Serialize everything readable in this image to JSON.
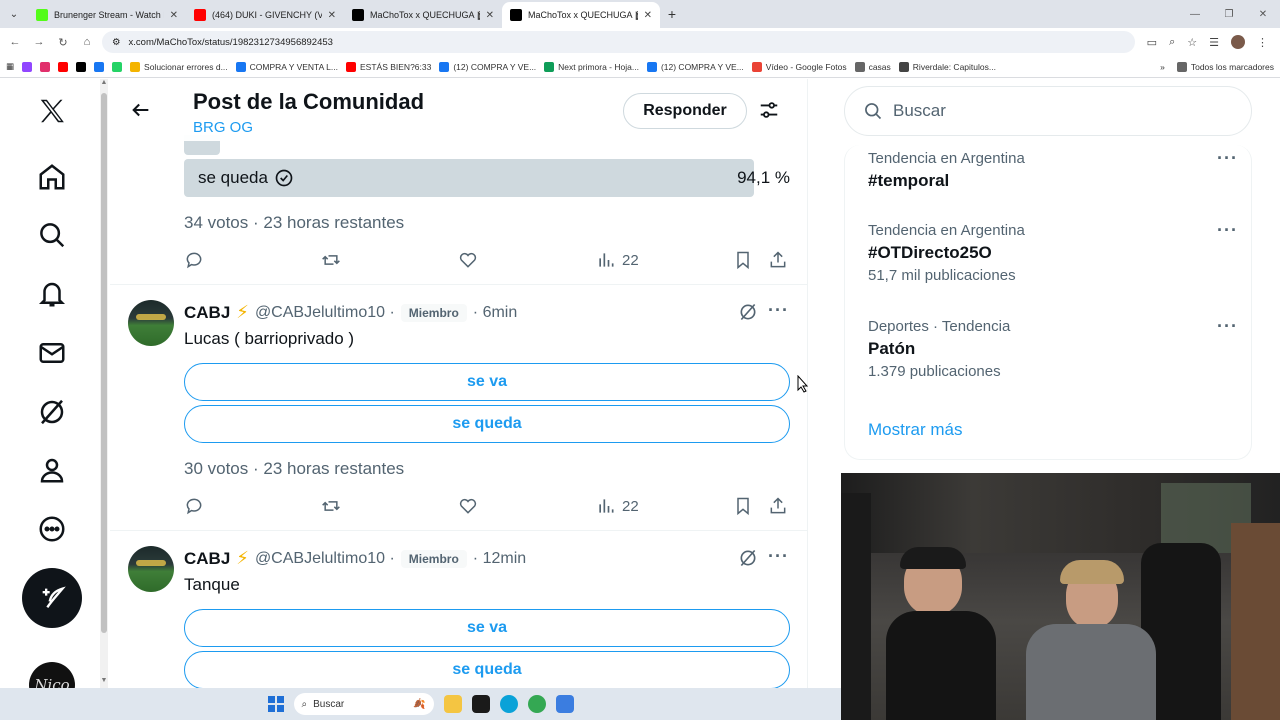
{
  "browser": {
    "tabs": [
      {
        "title": "Brunenger Stream - Watch Live",
        "favicon_color": "#53fc18"
      },
      {
        "title": "(464) DUKI - GIVENCHY (Vi",
        "favicon_color": "#ff0000"
      },
      {
        "title": "MaChoTox x QUECHUGA 🎬 e",
        "favicon_color": "#000000"
      },
      {
        "title": "MaChoTox x QUECHUGA 🎬 e",
        "favicon_color": "#000000"
      }
    ],
    "url": "x.com/MaChoTox/status/1982312734956892453",
    "bookmarks": [
      {
        "label": "Solucionar errores d...",
        "color": "#f4b400"
      },
      {
        "label": "COMPRA Y VENTA L...",
        "color": "#1877f2"
      },
      {
        "label": "ESTÁS BIEN?6:33",
        "color": "#ff0000"
      },
      {
        "label": "(12) COMPRA Y VE...",
        "color": "#1877f2"
      },
      {
        "label": "Next primora - Hoja...",
        "color": "#0f9d58"
      },
      {
        "label": "(12) COMPRA Y VE...",
        "color": "#1877f2"
      },
      {
        "label": "Vídeo - Google Fotos",
        "color": "#ea4335"
      },
      {
        "label": "casas",
        "color": "#666666"
      },
      {
        "label": "Riverdale: Capitulos...",
        "color": "#444444"
      }
    ],
    "all_bookmarks": "Todos los marcadores"
  },
  "header": {
    "title": "Post de la Comunidad",
    "subtitle": "BRG OG",
    "reply_label": "Responder"
  },
  "top_poll": {
    "option_label": "se queda",
    "percent": "94,1 %",
    "percent_value": 94.1,
    "meta": "34 votos · 23 horas restantes",
    "views": "22"
  },
  "posts": [
    {
      "name": "CABJ",
      "handle": "@CABJelultimo10 ·",
      "badge": "Miembro",
      "time": "· 6min",
      "text": "Lucas ( barrioprivado )",
      "options": [
        "se va",
        "se queda"
      ],
      "meta": "30 votos · 23 horas restantes",
      "views": "22"
    },
    {
      "name": "CABJ",
      "handle": "@CABJelultimo10 ·",
      "badge": "Miembro",
      "time": "· 12min",
      "text": "Tanque",
      "options": [
        "se va",
        "se queda"
      ]
    }
  ],
  "sidebar": {
    "search_placeholder": "Buscar",
    "trends": [
      {
        "context": "Tendencia en Argentina",
        "name": "#temporal",
        "count": ""
      },
      {
        "context": "Tendencia en Argentina",
        "name": "#OTDirecto25O",
        "count": "51,7 mil publicaciones"
      },
      {
        "context": "Deportes · Tendencia",
        "name": "Patón",
        "count": "1.379 publicaciones"
      }
    ],
    "show_more": "Mostrar más"
  },
  "nav_avatar_text": "Nico",
  "taskbar": {
    "search_label": "Buscar"
  },
  "colors": {
    "accent": "#1d9bf0",
    "text": "#0f1419",
    "muted": "#536471"
  }
}
